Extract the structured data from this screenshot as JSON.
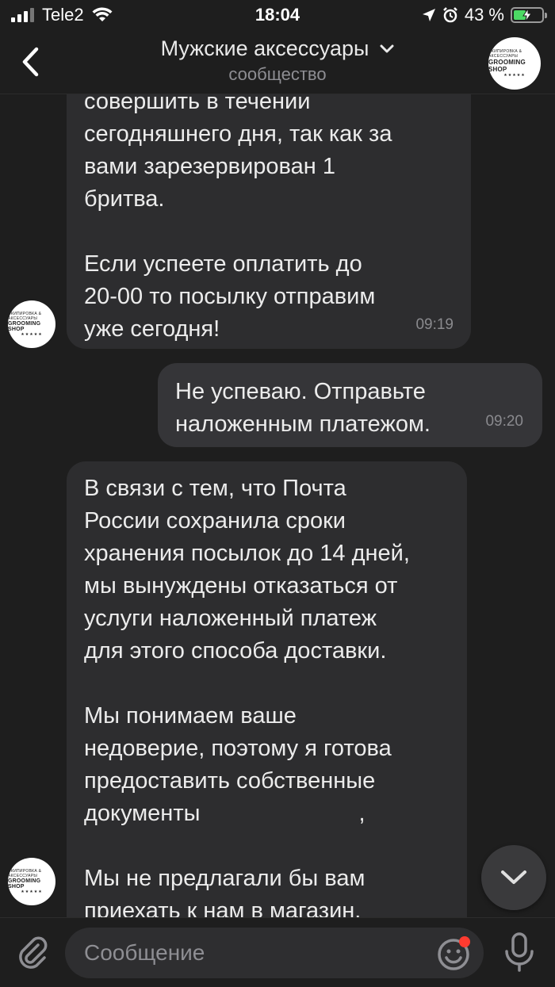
{
  "status_bar": {
    "carrier": "Tele2",
    "time": "18:04",
    "battery_percent": "43 %",
    "battery_level": 0.43
  },
  "header": {
    "title": "Мужские аксессуары",
    "subtitle": "сообщество",
    "avatar_text_top": "ЭКИПИРОВКА & АКСЕССУАРЫ",
    "avatar_brand": "GROOMING SHOP",
    "avatar_stars": "★★★★★"
  },
  "messages": [
    {
      "direction": "in",
      "text": "совершить в течении\nсегодняшнего дня, так как за\nвами зарезервирован 1\nбритва.\n\nЕсли успеете оплатить до\n20-00 то посылку отправим\nуже сегодня!",
      "time": "09:19"
    },
    {
      "direction": "out",
      "text": "Не успеваю. Отправьте\nналоженным платежом.",
      "time": "09:20"
    },
    {
      "direction": "in",
      "text_part1": "В связи с тем, что Почта\nРоссии сохранила сроки\nхранения посылок до 14 дней,\nмы вынуждены отказаться от\nуслуги наложенный платеж\nдля этого способа доставки.\n\nМы понимаем ваше\nнедоверие, поэтому я готова\nпредоставить собственные\nдокументы",
      "text_part2": ",",
      "text_part3": "\n\nМы не предлагали бы вам\nприехать к нам в магазин."
    }
  ],
  "composer": {
    "placeholder": "Сообщение"
  },
  "icons": {
    "back": "chevron-left-icon",
    "title_dropdown": "chevron-down-icon",
    "attach": "paperclip-icon",
    "emoji": "smiley-icon",
    "mic": "microphone-icon",
    "scroll_down": "chevron-down-icon"
  },
  "colors": {
    "background": "#1e1e1e",
    "bubble_in": "#2d2d2f",
    "bubble_out": "#353538",
    "battery_fill": "#4cd964",
    "notify_dot": "#ff3b30"
  }
}
